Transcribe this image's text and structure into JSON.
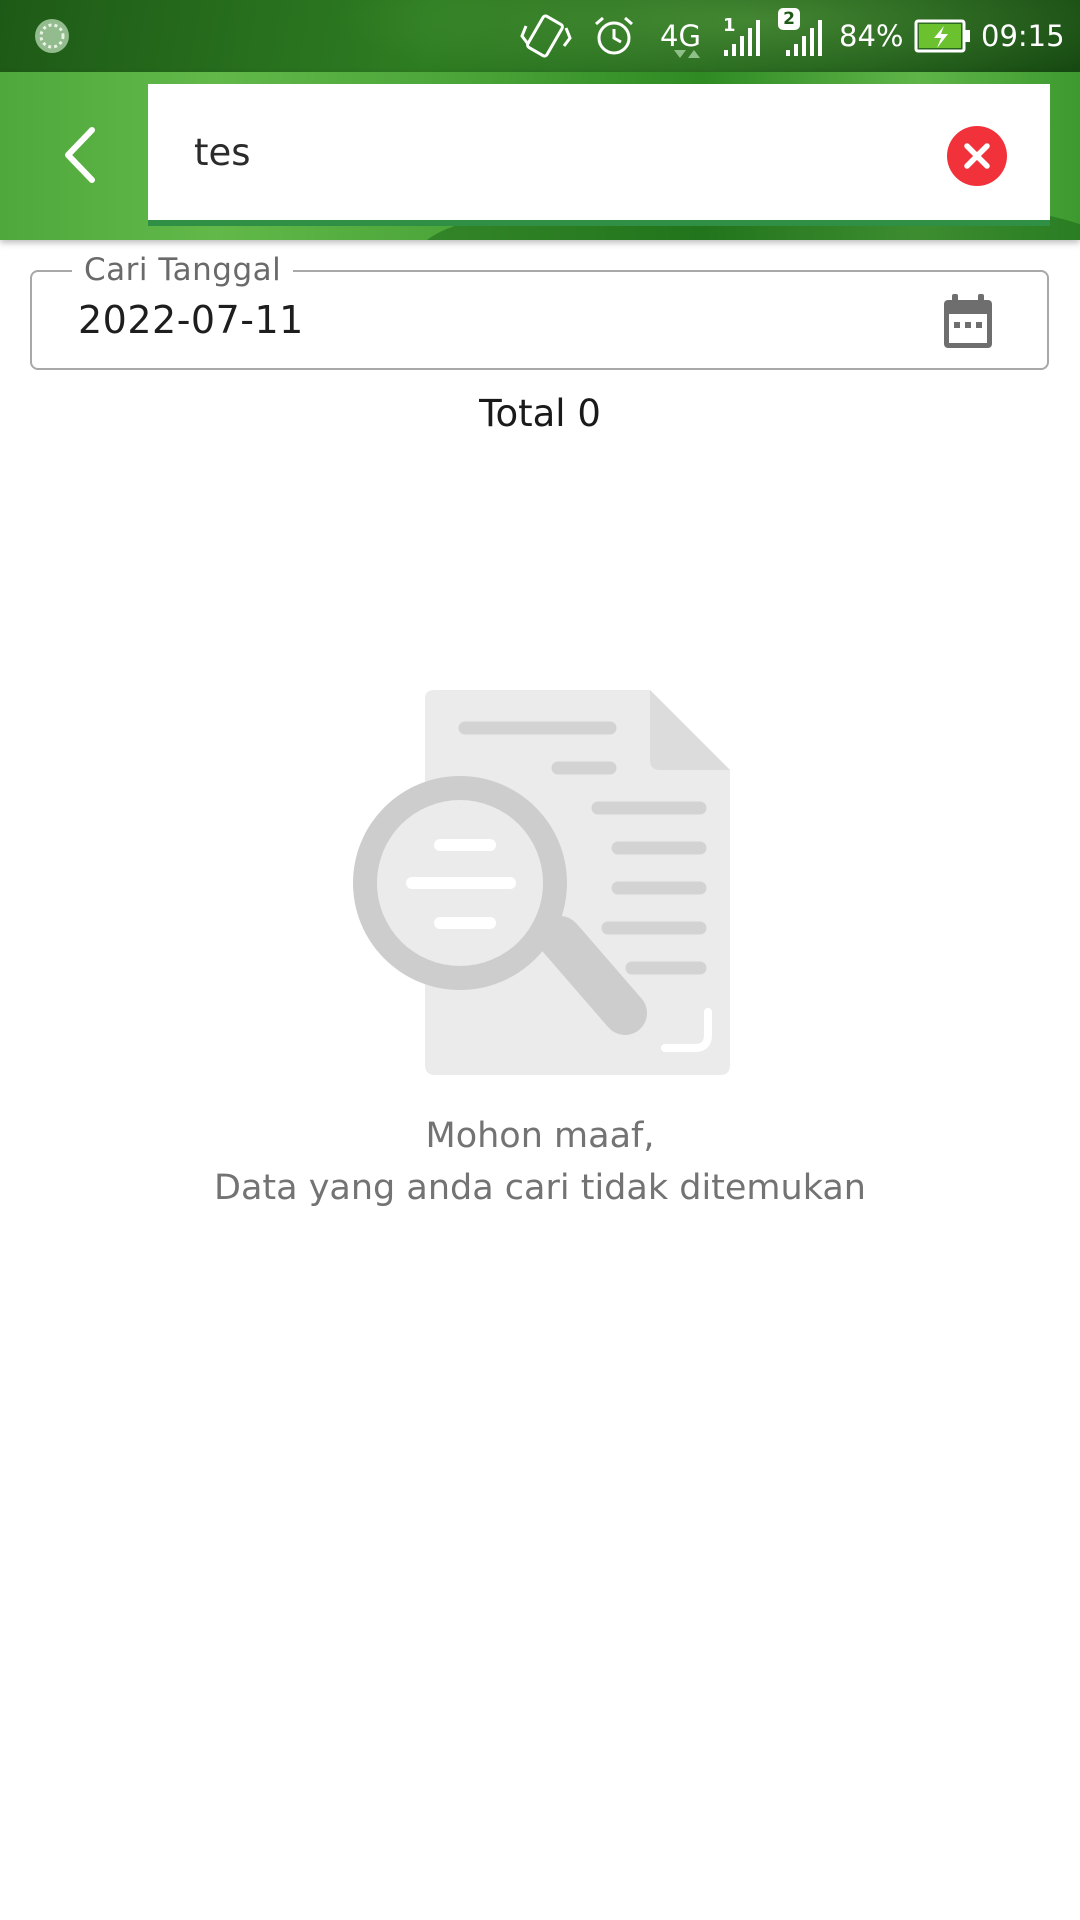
{
  "status_bar": {
    "battery": "84%",
    "time": "09:15",
    "network": "4G",
    "sim1_badge": "1",
    "sim2_badge": "2",
    "icons": [
      "loading-icon",
      "vibrate-icon",
      "alarm-icon",
      "signal-icon",
      "battery-charging-icon"
    ]
  },
  "appbar": {
    "search_value": "tes",
    "search_placeholder": "",
    "back_icon": "chevron-left-icon",
    "clear_icon": "close-circle-icon",
    "accent_color": "#2f8f45",
    "clear_color": "#f2323a"
  },
  "date_filter": {
    "label": "Cari Tanggal",
    "value": "2022-07-11",
    "icon": "calendar-icon"
  },
  "total_text": "Total 0",
  "empty_state": {
    "illustration": "document-search-icon",
    "line1": "Mohon maaf,",
    "line2": "Data yang anda cari tidak ditemukan"
  }
}
